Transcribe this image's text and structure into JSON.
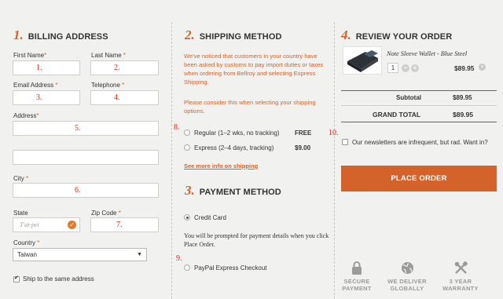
{
  "billing": {
    "num": "1.",
    "title": "BILLING ADDRESS",
    "first_name_label": "First Name",
    "last_name_label": "Last Name",
    "email_label": "Email Address",
    "telephone_label": "Telephone",
    "address_label": "Address",
    "city_label": "City",
    "state_label": "State",
    "state_placeholder": "T'ai-pei",
    "zip_label": "Zip Code",
    "country_label": "Country",
    "country_value": "Taiwan",
    "ship_same_label": "Ship to the same address",
    "required_mark": "*"
  },
  "annotations": {
    "first_name": "1.",
    "last_name": "2.",
    "email": "3.",
    "telephone": "4.",
    "address": "5.",
    "city": "6.",
    "zip": "7.",
    "shipping": "8.",
    "paypal": "9.",
    "newsletter": "10."
  },
  "shipping": {
    "num": "2.",
    "title": "SHIPPING METHOD",
    "notice_1": "We've noticed that customers in your country have been asked by customs to pay import duties or taxes when ordering from Bellroy and selecting Express Shipping.",
    "notice_2": "Please consider this when selecting your shipping options.",
    "options": [
      {
        "label": "Regular (1–2 wks, no tracking)",
        "price": "FREE",
        "selected": false
      },
      {
        "label": "Express (2–4 days, tracking)",
        "price": "$9.00",
        "selected": false
      }
    ],
    "more_info_link": "See more info on shipping"
  },
  "payment": {
    "num": "3.",
    "title": "PAYMENT METHOD",
    "credit_card_label": "Credit Card",
    "credit_card_note": "You will be prompted for payment details when you click Place Order.",
    "paypal_label": "PayPal Express Checkout"
  },
  "review": {
    "num": "4.",
    "title": "REVIEW YOUR ORDER",
    "item_name": "Note Sleeve Wallet - Blue Steel",
    "item_qty": "1",
    "item_price": "$89.95",
    "subtotal_label": "Subtotal",
    "subtotal_value": "$89.95",
    "grand_total_label": "GRAND TOTAL",
    "grand_total_value": "$89.95",
    "newsletter_label": "Our newsletters are infrequent, but rad. Want in?",
    "place_order_label": "PLACE ORDER"
  },
  "badges": [
    {
      "line1": "SECURE",
      "line2": "PAYMENT",
      "icon": "lock-icon"
    },
    {
      "line1": "WE DELIVER",
      "line2": "GLOBALLY",
      "icon": "globe-icon"
    },
    {
      "line1": "3 YEAR",
      "line2": "WARRANTY",
      "icon": "tools-icon"
    }
  ],
  "colors": {
    "accent": "#d3632b",
    "annotation": "#d62a16",
    "background": "#f1f1ef",
    "badge_gray": "#9b9b97"
  }
}
